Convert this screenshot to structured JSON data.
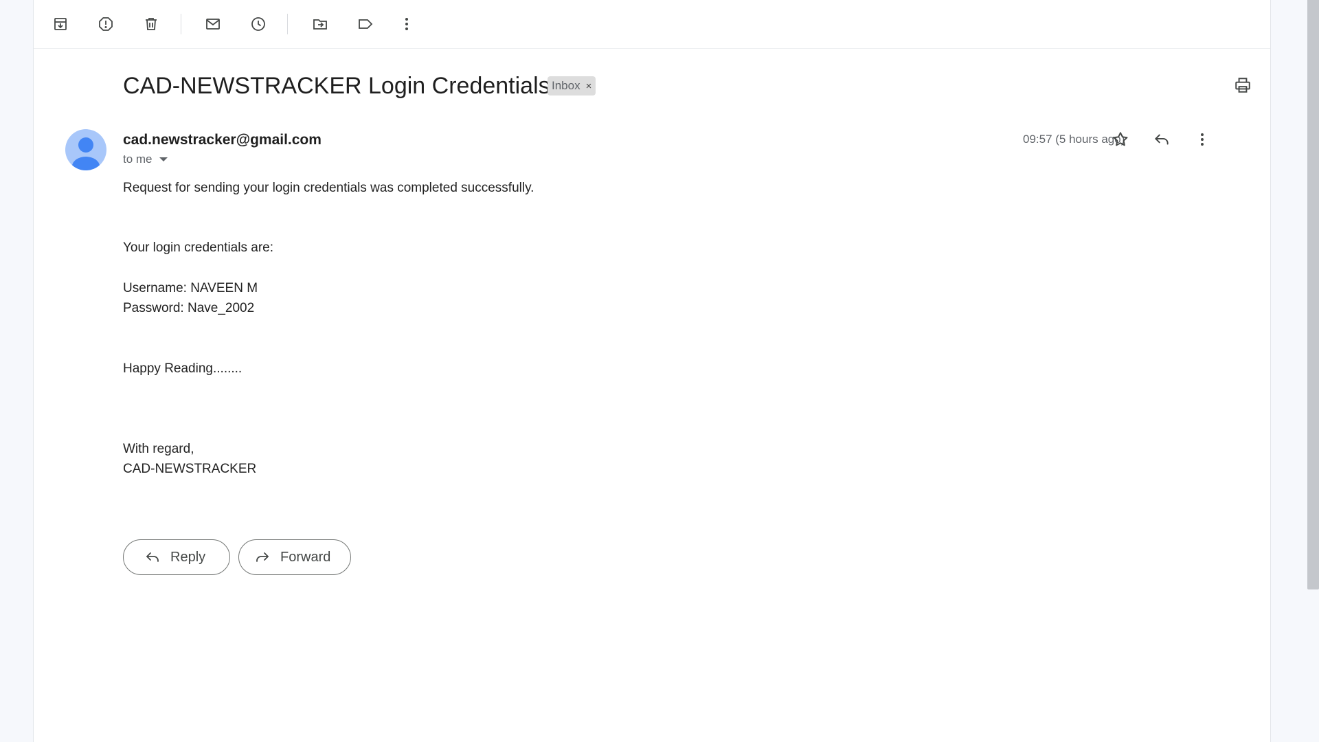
{
  "toolbar": {
    "icons": [
      "archive-icon",
      "report-spam-icon",
      "delete-icon",
      "mark-unread-icon",
      "snooze-icon",
      "move-to-icon",
      "label-icon",
      "more-vert-icon"
    ]
  },
  "email": {
    "subject": "CAD-NEWSTRACKER Login Credentials",
    "label": "Inbox",
    "label_remove": "×",
    "sender": "cad.newstracker@gmail.com",
    "recipient": "to me",
    "timestamp": "09:57 (5 hours ago)",
    "body": {
      "line1": "Request for sending your login credentials was completed successfully.",
      "line2": "Your login credentials are:",
      "line3": "Username: NAVEEN M",
      "line4": "Password: Nave_2002",
      "line5": "Happy Reading........",
      "line6": "With regard,",
      "line7": "CAD-NEWSTRACKER"
    }
  },
  "actions": {
    "reply_label": "Reply",
    "forward_label": "Forward"
  },
  "colors": {
    "avatar_bg": "#a8c7fa",
    "avatar_fg": "#4285f4",
    "icon": "#444746",
    "chip_bg": "#dddddd"
  }
}
